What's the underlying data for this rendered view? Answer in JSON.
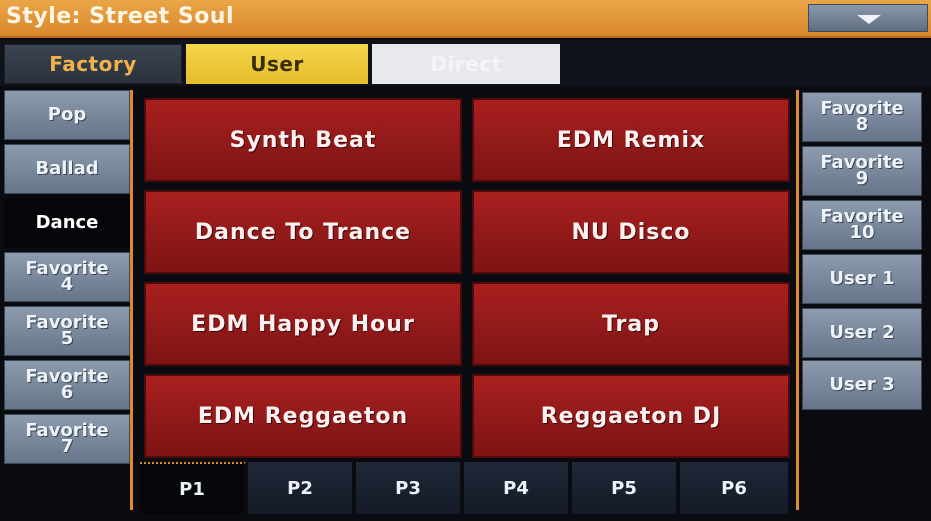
{
  "header": {
    "title": "Style: Street Soul"
  },
  "tabs": [
    {
      "label": "Factory"
    },
    {
      "label": "User"
    },
    {
      "label": "Direct"
    }
  ],
  "left_categories": [
    {
      "line1": "Pop",
      "line2": ""
    },
    {
      "line1": "Ballad",
      "line2": ""
    },
    {
      "line1": "Dance",
      "line2": ""
    },
    {
      "line1": "Favorite",
      "line2": "4"
    },
    {
      "line1": "Favorite",
      "line2": "5"
    },
    {
      "line1": "Favorite",
      "line2": "6"
    },
    {
      "line1": "Favorite",
      "line2": "7"
    }
  ],
  "right_categories": [
    {
      "line1": "Favorite",
      "line2": "8"
    },
    {
      "line1": "Favorite",
      "line2": "9"
    },
    {
      "line1": "Favorite",
      "line2": "10"
    },
    {
      "line1": "User 1",
      "line2": ""
    },
    {
      "line1": "User 2",
      "line2": ""
    },
    {
      "line1": "User 3",
      "line2": ""
    }
  ],
  "styles": [
    "Synth Beat",
    "EDM Remix",
    "Dance To Trance",
    "NU Disco",
    "EDM Happy Hour",
    "Trap",
    "EDM Reggaeton",
    "Reggaeton DJ"
  ],
  "pages": [
    "P1",
    "P2",
    "P3",
    "P4",
    "P5",
    "P6"
  ],
  "selected": {
    "tab": "User",
    "category": "Dance",
    "page": "P1"
  },
  "colors": {
    "title_bar": "#e29a3c",
    "style_button": "#9a1c1b",
    "accent": "#e08a2e",
    "user_tab": "#f0cc3f"
  }
}
